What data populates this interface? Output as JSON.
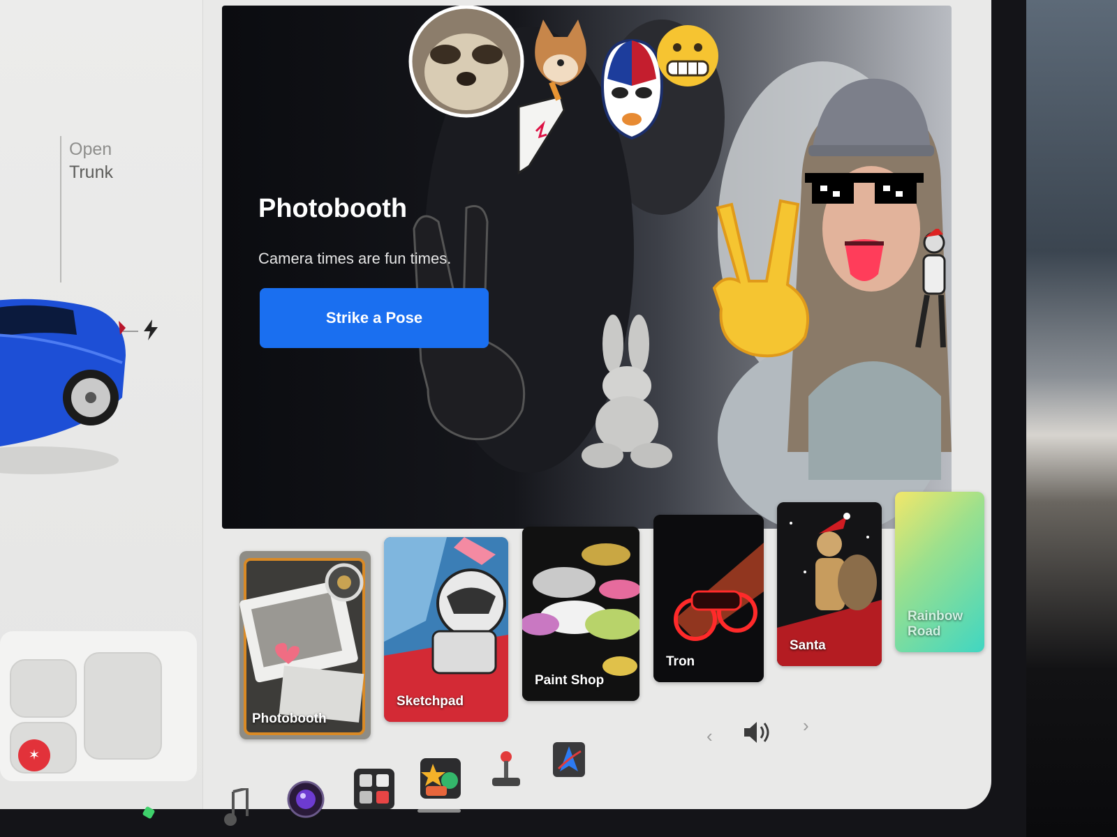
{
  "car_panel": {
    "trunk": {
      "line1": "Open",
      "line2": "Trunk"
    }
  },
  "hero": {
    "title": "Photobooth",
    "subtitle": "Camera times are fun times.",
    "cta_label": "Strike a Pose"
  },
  "tiles": [
    {
      "label": "Photobooth"
    },
    {
      "label": "Sketchpad"
    },
    {
      "label": "Paint Shop"
    },
    {
      "label": "Tron"
    },
    {
      "label": "Santa"
    },
    {
      "label": "Rainbow Road"
    }
  ],
  "dock": {
    "icons": [
      "music-icon",
      "camera-icon",
      "apps-icon",
      "toybox-icon",
      "joystick-icon",
      "navigation-icon"
    ],
    "volume": {
      "prev": "‹",
      "next": "›"
    }
  },
  "colors": {
    "accent": "#1a6ff0",
    "car_blue": "#1d4fd6",
    "defrost_red": "#e2323a"
  }
}
